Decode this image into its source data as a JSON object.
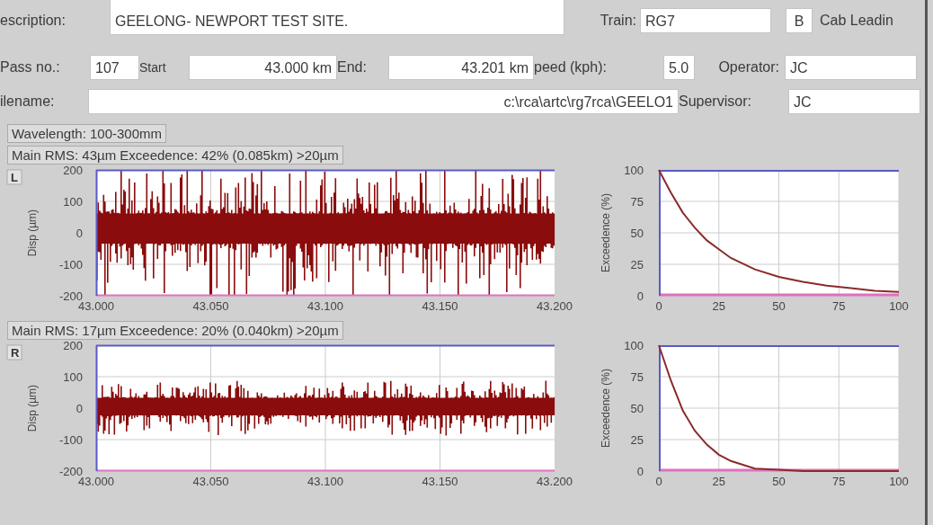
{
  "form": {
    "description_label": "escription:",
    "description": "GEELONG- NEWPORT TEST SITE.",
    "train_label": "Train:",
    "train": "RG7",
    "train_end": "B",
    "cab_label": "Cab Leadin",
    "pass_label": "Pass no.:",
    "pass": "107",
    "start_label": "Start",
    "start": "43.000 km",
    "end_label": "End:",
    "end": "43.201 km",
    "speed_label": "peed (kph):",
    "speed": "5.0",
    "operator_label": "Operator:",
    "operator": "JC",
    "filename_label": "ilename:",
    "filename": "c:\\rca\\artc\\rg7rca\\GEELO1",
    "supervisor_label": "Supervisor:",
    "supervisor": "JC"
  },
  "wavelength": "Wavelength: 100-300mm",
  "channels": [
    {
      "summary": "Main RMS: 43µm Exceedence: 42% (0.085km) >20µm",
      "badge": "L",
      "signal": {
        "ylabel": "Disp (µm)",
        "yticks": [
          "200",
          "100",
          "0",
          "-100",
          "-200"
        ],
        "xticks": [
          "43.000",
          "43.050",
          "43.100",
          "43.150",
          "43.200"
        ]
      },
      "chart_data": {
        "type": "line",
        "ylabel": "Exceedence (%)",
        "x": [
          0,
          5,
          10,
          15,
          20,
          25,
          30,
          40,
          50,
          60,
          70,
          80,
          90,
          100
        ],
        "xlim": [
          0,
          100
        ],
        "ylim": [
          0,
          100
        ],
        "xticks": [
          0,
          25,
          50,
          75,
          100
        ],
        "yticks": [
          0,
          25,
          50,
          75,
          100
        ],
        "grid": true,
        "series": [
          {
            "color": "#8b2a2a",
            "values": [
              100,
              82,
              66,
              54,
              44,
              37,
              30,
              21,
              15,
              11,
              8,
              6,
              4,
              3
            ]
          }
        ]
      }
    },
    {
      "summary": "Main RMS: 17µm Exceedence: 20% (0.040km) >20µm",
      "badge": "R",
      "signal": {
        "ylabel": "Disp (µm)",
        "yticks": [
          "200",
          "100",
          "0",
          "-100",
          "-200"
        ],
        "xticks": [
          "43.000",
          "43.050",
          "43.100",
          "43.150",
          "43.200"
        ]
      },
      "chart_data": {
        "type": "line",
        "ylabel": "Exceedence (%)",
        "x": [
          0,
          5,
          10,
          15,
          20,
          25,
          30,
          40,
          50,
          60,
          70,
          80,
          90,
          100
        ],
        "xlim": [
          0,
          100
        ],
        "ylim": [
          0,
          100
        ],
        "xticks": [
          0,
          25,
          50,
          75,
          100
        ],
        "yticks": [
          0,
          25,
          50,
          75,
          100
        ],
        "grid": true,
        "series": [
          {
            "color": "#8b2a2a",
            "values": [
              100,
              72,
              48,
              32,
              21,
              13,
              8,
              2,
              1,
              0,
              0,
              0,
              0,
              0
            ]
          }
        ]
      }
    }
  ]
}
